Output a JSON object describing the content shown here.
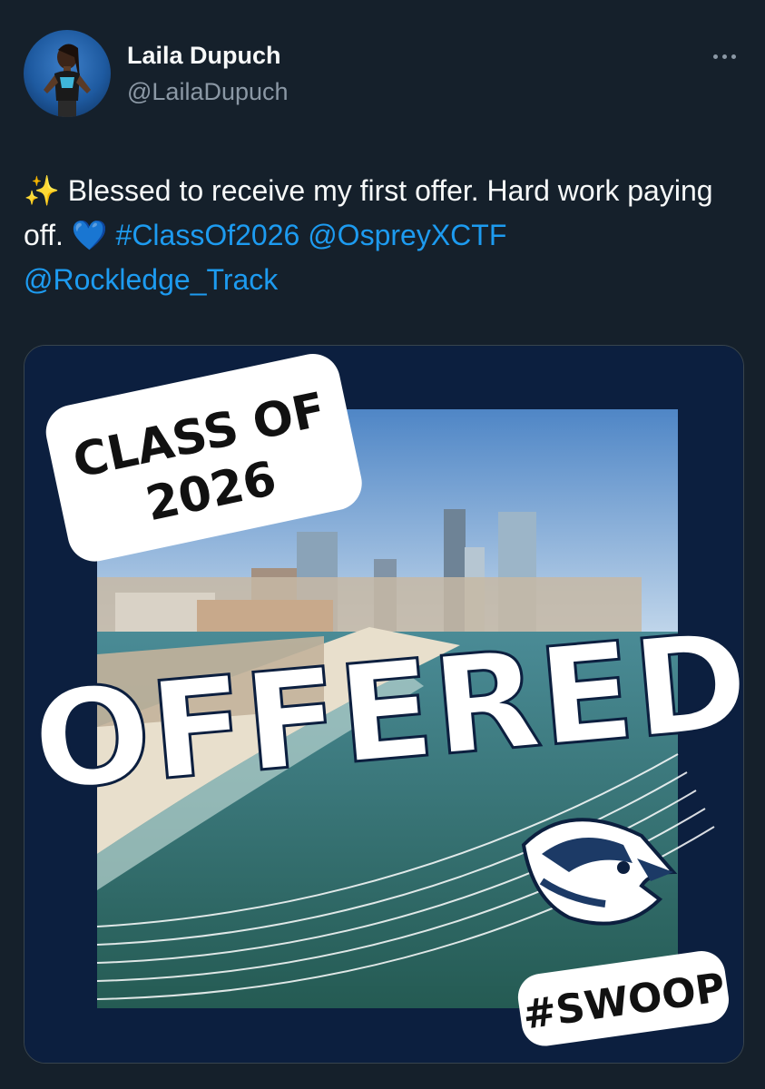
{
  "user": {
    "display_name": "Laila Dupuch",
    "handle": "@LailaDupuch"
  },
  "tweet": {
    "sparkle_emoji": "✨",
    "text_part1": " Blessed to receive my first offer. Hard work paying off. ",
    "heart_emoji": "💙",
    "hashtag": "#ClassOf2026",
    "mention1": "@OspreyXCTF",
    "mention2": "@Rockledge_Track"
  },
  "graphic": {
    "class_of_line1": "CLASS OF",
    "class_of_line2": "2026",
    "offered": "OFFERED",
    "swoop": "#SWOOP"
  },
  "icons": {
    "more": "more-options-icon",
    "logo": "osprey-mascot-logo"
  },
  "colors": {
    "background": "#15202b",
    "link": "#1d9bf0",
    "secondary_text": "#8b98a5",
    "graphic_navy": "#0c1f3f"
  }
}
